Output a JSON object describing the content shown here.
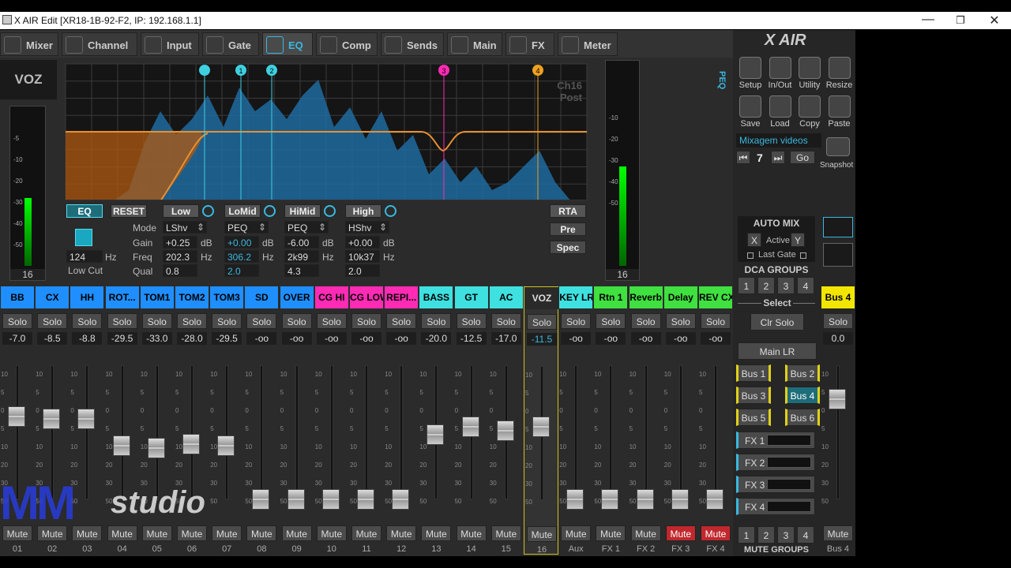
{
  "window": {
    "title": "X AIR Edit [XR18-1B-92-F2, IP: 192.168.1.1]",
    "minimize": "—",
    "restore": "❐",
    "close": "✕"
  },
  "tabs": [
    {
      "label": "Mixer",
      "active": false
    },
    {
      "label": "Channel",
      "active": false
    },
    {
      "label": "Input",
      "active": false
    },
    {
      "label": "Gate",
      "active": false
    },
    {
      "label": "EQ",
      "active": true
    },
    {
      "label": "Comp",
      "active": false
    },
    {
      "label": "Sends",
      "active": false
    },
    {
      "label": "Main",
      "active": false
    },
    {
      "label": "FX",
      "active": false
    },
    {
      "label": "Meter",
      "active": false
    }
  ],
  "channel_name": "VOZ",
  "eq": {
    "info_line1": "Ch16",
    "info_line2": "Post",
    "band_markers": [
      "",
      "1",
      "2",
      "3",
      "4"
    ],
    "eq_button": "EQ",
    "reset_button": "RESET",
    "row_labels": {
      "mode": "Mode",
      "gain": "Gain",
      "freq": "Freq",
      "qual": "Qual"
    },
    "low_cut": {
      "freq": "124",
      "unit": "Hz",
      "label": "Low Cut"
    },
    "units": {
      "db": "dB",
      "hz": "Hz"
    },
    "bands": [
      {
        "name": "Low",
        "mode": "LShv",
        "gain": "+0.25",
        "freq": "202.3",
        "qual": "0.8"
      },
      {
        "name": "LoMid",
        "mode": "PEQ",
        "gain": "+0.00",
        "freq": "306.2",
        "qual": "2.0"
      },
      {
        "name": "HiMid",
        "mode": "PEQ",
        "gain": "-6.00",
        "freq": "2k99",
        "qual": "4.3"
      },
      {
        "name": "High",
        "mode": "HShv",
        "gain": "+0.00",
        "freq": "10k37",
        "qual": "2.0"
      }
    ],
    "rta": "RTA",
    "pre": "Pre",
    "spec": "Spec",
    "peq_label": "PEQ",
    "mode_arrow": "⇕"
  },
  "left_meter": {
    "scale": [
      "-5",
      "-10",
      "-20",
      "-30",
      "-40",
      "-50"
    ],
    "label": "16"
  },
  "right_meter": {
    "scale": [
      "-10",
      "-20",
      "-30",
      "-40",
      "-50"
    ],
    "label": "16"
  },
  "strips": [
    {
      "name": "BB",
      "color": "#1f8fff",
      "level": "-7.0",
      "num": "01",
      "fader": 0.62,
      "mute": false
    },
    {
      "name": "CX",
      "color": "#1f8fff",
      "level": "-8.5",
      "num": "02",
      "fader": 0.6,
      "mute": false
    },
    {
      "name": "HH",
      "color": "#1f8fff",
      "level": "-8.8",
      "num": "03",
      "fader": 0.6,
      "mute": false
    },
    {
      "name": "ROT...",
      "color": "#1f8fff",
      "level": "-29.5",
      "num": "04",
      "fader": 0.4,
      "mute": false
    },
    {
      "name": "TOM1",
      "color": "#1f8fff",
      "level": "-33.0",
      "num": "05",
      "fader": 0.38,
      "mute": false
    },
    {
      "name": "TOM2",
      "color": "#1f8fff",
      "level": "-28.0",
      "num": "06",
      "fader": 0.41,
      "mute": false
    },
    {
      "name": "TOM3",
      "color": "#1f8fff",
      "level": "-29.5",
      "num": "07",
      "fader": 0.4,
      "mute": false
    },
    {
      "name": "SD",
      "color": "#1f8fff",
      "level": "-oo",
      "num": "08",
      "fader": 0.0,
      "mute": false
    },
    {
      "name": "OVER",
      "color": "#1f8fff",
      "level": "-oo",
      "num": "09",
      "fader": 0.0,
      "mute": false
    },
    {
      "name": "CG HI",
      "color": "#ff2bb5",
      "level": "-oo",
      "num": "10",
      "fader": 0.0,
      "mute": false
    },
    {
      "name": "CG LOW",
      "color": "#ff2bb5",
      "level": "-oo",
      "num": "11",
      "fader": 0.0,
      "mute": false
    },
    {
      "name": "REPI...",
      "color": "#ff2bb5",
      "level": "-oo",
      "num": "12",
      "fader": 0.0,
      "mute": false
    },
    {
      "name": "BASS",
      "color": "#3fe0e0",
      "level": "-20.0",
      "num": "13",
      "fader": 0.48,
      "mute": false
    },
    {
      "name": "GT",
      "color": "#3fe0e0",
      "level": "-12.5",
      "num": "14",
      "fader": 0.54,
      "mute": false
    },
    {
      "name": "AC",
      "color": "#3fe0e0",
      "level": "-17.0",
      "num": "15",
      "fader": 0.51,
      "mute": false
    },
    {
      "name": "VOZ",
      "color": "#2a2a2a",
      "level": "-11.5",
      "num": "16",
      "fader": 0.55,
      "mute": false
    },
    {
      "name": "KEY LR",
      "color": "#3fe0e0",
      "level": "-oo",
      "num": "Aux",
      "fader": 0.0,
      "mute": false
    },
    {
      "name": "Rtn 1",
      "color": "#3fe03f",
      "level": "-oo",
      "num": "FX 1",
      "fader": 0.0,
      "mute": false
    },
    {
      "name": "Reverb",
      "color": "#3fe03f",
      "level": "-oo",
      "num": "FX 2",
      "fader": 0.0,
      "mute": false
    },
    {
      "name": "Delay",
      "color": "#3fe03f",
      "level": "-oo",
      "num": "FX 3",
      "fader": 0.0,
      "mute": true
    },
    {
      "name": "REV CX",
      "color": "#3fe03f",
      "level": "-oo",
      "num": "FX 4",
      "fader": 0.0,
      "mute": true
    }
  ],
  "strip_labels": {
    "solo": "Solo",
    "mute": "Mute"
  },
  "fader_scale": [
    "10",
    "5",
    "0",
    "5",
    "10",
    "20",
    "30",
    "50"
  ],
  "bus4": {
    "name": "Bus 4",
    "color": "#f2e600",
    "level": "0.0",
    "num": "Bus 4",
    "fader": 0.75
  },
  "right_panel": {
    "logo": "X AIR",
    "tools": [
      "Setup",
      "In/Out",
      "Utility",
      "Resize",
      "Save",
      "Load",
      "Copy",
      "Paste"
    ],
    "snapshot_name": "Mixagem videos",
    "snapshot_index": "7",
    "go": "Go",
    "snapshot_label": "Snapshot",
    "auto_mix": "AUTO MIX",
    "automix_x": "X",
    "active": "Active",
    "automix_y": "Y",
    "last_gate": "Last Gate",
    "dca_groups": "DCA GROUPS",
    "dca": [
      "1",
      "2",
      "3",
      "4"
    ],
    "select": "Select",
    "clr_solo": "Clr Solo",
    "main_lr": "Main LR",
    "buses": [
      "Bus 1",
      "Bus 2",
      "Bus 3",
      "Bus 4",
      "Bus 5",
      "Bus 6"
    ],
    "fx": [
      "FX 1",
      "FX 2",
      "FX 3",
      "FX 4"
    ],
    "mute_groups": [
      "1",
      "2",
      "3",
      "4"
    ],
    "mute_groups_label": "MUTE GROUPS"
  },
  "watermark": {
    "text1": "MM",
    "text2": "studio"
  }
}
